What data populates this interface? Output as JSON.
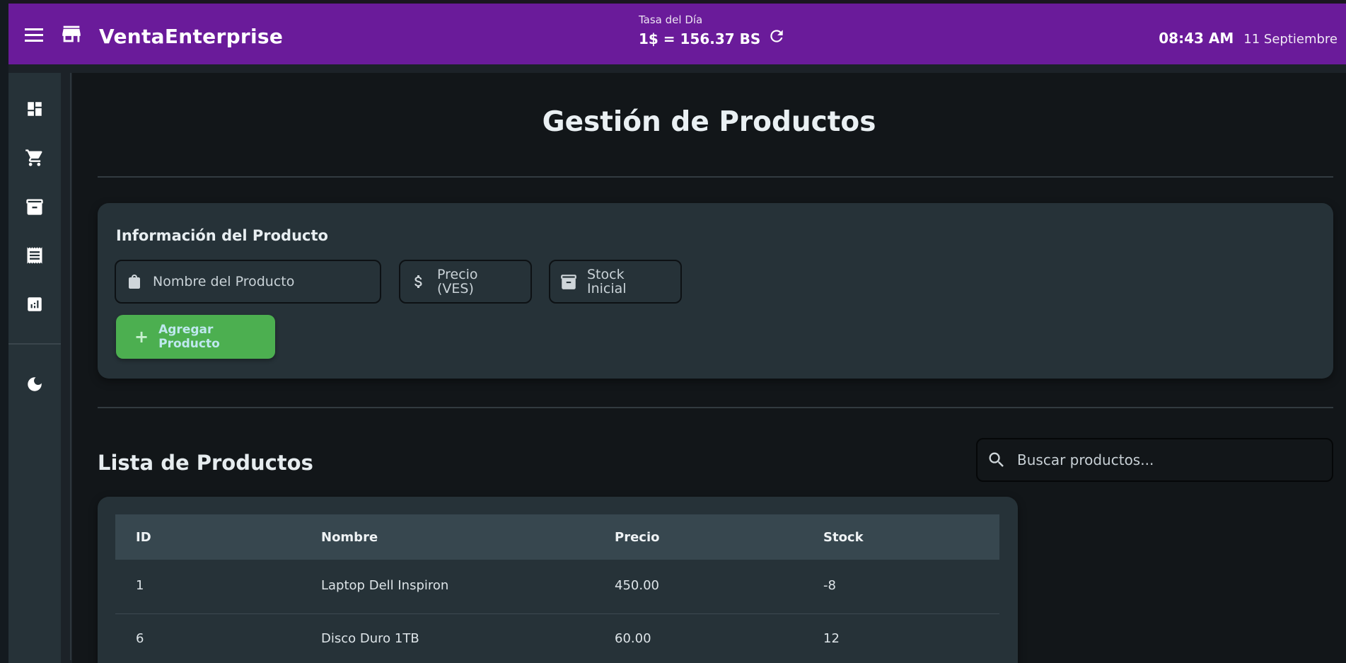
{
  "header": {
    "app_title": "VentaEnterprise",
    "rate_label": "Tasa del Día",
    "rate_value": "1$ = 156.37 BS",
    "time": "08:43 AM",
    "date": "11 Septiembre",
    "brand_color": "#6a1b9a"
  },
  "sidebar": {
    "items": [
      {
        "name": "dashboard",
        "icon": "dashboard-icon"
      },
      {
        "name": "sales",
        "icon": "cart-icon"
      },
      {
        "name": "inventory",
        "icon": "archive-icon"
      },
      {
        "name": "receipts",
        "icon": "receipt-icon"
      },
      {
        "name": "reports",
        "icon": "analytics-icon"
      }
    ],
    "theme_toggle": {
      "icon": "moon-icon"
    }
  },
  "main": {
    "page_title": "Gestión de Productos",
    "form": {
      "title": "Información del Producto",
      "name_placeholder": "Nombre del Producto",
      "price_placeholder_line1": "Precio",
      "price_placeholder_line2": "(VES)",
      "stock_placeholder_line1": "Stock",
      "stock_placeholder_line2": "Inicial",
      "add_button_label": "Agregar Producto",
      "add_button_color": "#4caf50"
    },
    "list": {
      "title": "Lista de Productos",
      "search_placeholder": "Buscar productos...",
      "columns": [
        "ID",
        "Nombre",
        "Precio",
        "Stock"
      ],
      "rows": [
        {
          "id": "1",
          "nombre": "Laptop Dell Inspiron",
          "precio": "450.00",
          "stock": "-8"
        },
        {
          "id": "6",
          "nombre": "Disco Duro 1TB",
          "precio": "60.00",
          "stock": "12"
        }
      ]
    }
  }
}
